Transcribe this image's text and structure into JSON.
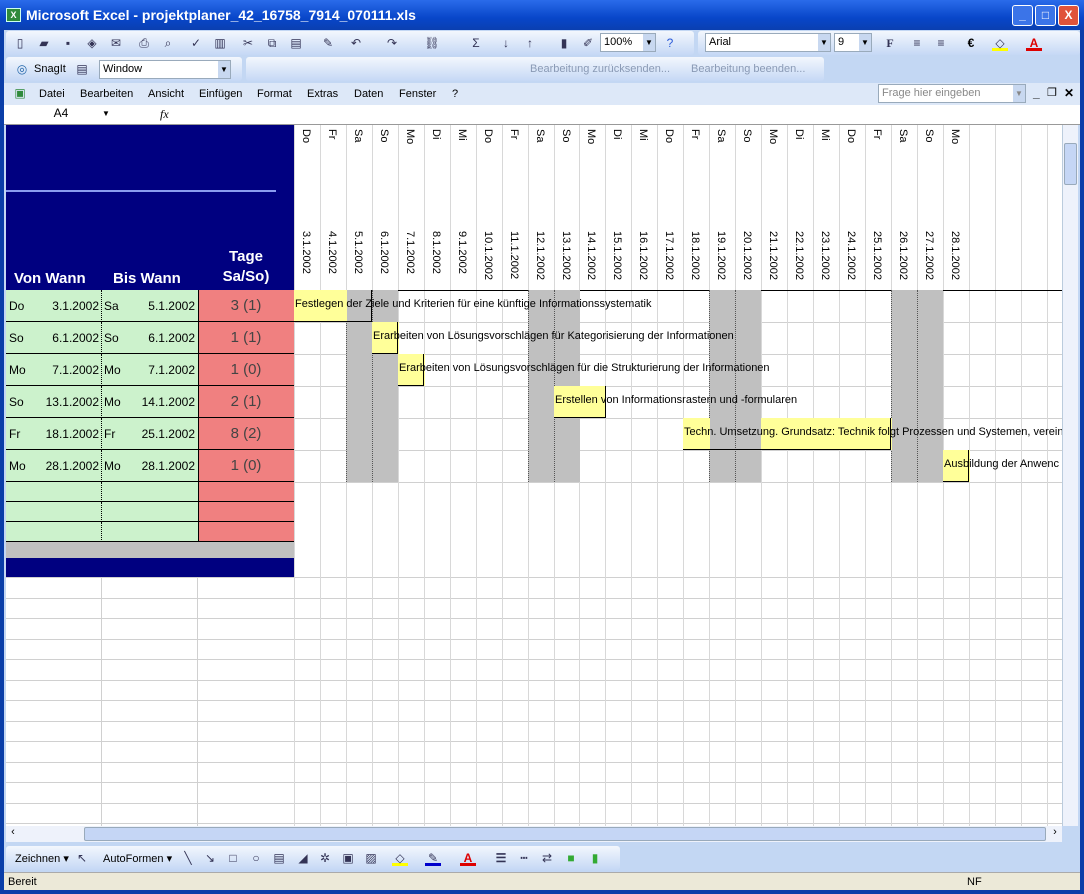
{
  "window": {
    "title": "Microsoft Excel - projektplaner_42_16758_7914_070111.xls",
    "minimize": "_",
    "maximize": "□",
    "close": "X"
  },
  "toolbar": {
    "zoom": "100%",
    "font": "Arial",
    "font_size": "9",
    "bold": "F",
    "euro": "€",
    "icons": [
      "new-icon",
      "open-icon",
      "save-icon",
      "permission-icon",
      "email-icon",
      "print-icon",
      "print-preview-icon",
      "spelling-icon",
      "research-icon",
      "cut-icon",
      "copy-icon",
      "paste-icon",
      "format-painter-icon",
      "undo-icon",
      "redo-icon",
      "hyperlink-icon",
      "autosum-icon",
      "sort-asc-icon",
      "sort-desc-icon",
      "chart-icon",
      "drawing-icon",
      "help-icon"
    ]
  },
  "snagit": {
    "label": "SnagIt",
    "window_combo": "Window",
    "review_send": "Bearbeitung zurücksenden...",
    "review_end": "Bearbeitung beenden..."
  },
  "menu": {
    "items": [
      "Datei",
      "Bearbeiten",
      "Ansicht",
      "Einfügen",
      "Format",
      "Extras",
      "Daten",
      "Fenster",
      "?"
    ],
    "help_placeholder": "Frage hier eingeben"
  },
  "formula_bar": {
    "name_box": "A4",
    "fx": "fx",
    "value": ""
  },
  "sheet": {
    "headers": {
      "von": "Von Wann",
      "bis": "Bis Wann",
      "tage": "Tage\nSa/So)"
    },
    "days": [
      "Do",
      "Fr",
      "Sa",
      "So",
      "Mo",
      "Di",
      "Mi",
      "Do",
      "Fr",
      "Sa",
      "So",
      "Mo",
      "Di",
      "Mi",
      "Do",
      "Fr",
      "Sa",
      "So",
      "Mo",
      "Di",
      "Mi",
      "Do",
      "Fr",
      "Sa",
      "So",
      "Mo"
    ],
    "dates": [
      "3.1.2002",
      "4.1.2002",
      "5.1.2002",
      "6.1.2002",
      "7.1.2002",
      "8.1.2002",
      "9.1.2002",
      "10.1.2002",
      "11.1.2002",
      "12.1.2002",
      "13.1.2002",
      "14.1.2002",
      "15.1.2002",
      "16.1.2002",
      "17.1.2002",
      "18.1.2002",
      "19.1.2002",
      "20.1.2002",
      "21.1.2002",
      "22.1.2002",
      "23.1.2002",
      "24.1.2002",
      "25.1.2002",
      "26.1.2002",
      "27.1.2002",
      "28.1.2002"
    ],
    "tasks": [
      {
        "von_day": "Do",
        "von": "3.1.2002",
        "bis_day": "Sa",
        "bis": "5.1.2002",
        "tage": "3 (1)",
        "start": 0,
        "end": 2,
        "text": "Festlegen der Ziele und Kriterien für eine künftige Informationssystematik"
      },
      {
        "von_day": "So",
        "von": "6.1.2002",
        "bis_day": "So",
        "bis": "6.1.2002",
        "tage": "1 (1)",
        "start": 3,
        "end": 3,
        "text": "Erarbeiten von Lösungsvorschlägen für Kategorisierung der Informationen"
      },
      {
        "von_day": "Mo",
        "von": "7.1.2002",
        "bis_day": "Mo",
        "bis": "7.1.2002",
        "tage": "1 (0)",
        "start": 4,
        "end": 4,
        "text": "Erarbeiten von Lösungsvorschlägen für die Strukturierung der Informationen"
      },
      {
        "von_day": "So",
        "von": "13.1.2002",
        "bis_day": "Mo",
        "bis": "14.1.2002",
        "tage": "2 (1)",
        "start": 10,
        "end": 11,
        "text": "Erstellen von Informationsrastern und -formularen"
      },
      {
        "von_day": "Fr",
        "von": "18.1.2002",
        "bis_day": "Fr",
        "bis": "25.1.2002",
        "tage": "8 (2)",
        "start": 15,
        "end": 22,
        "text": "Techn. Umsetzung. Grundsatz: Technik folgt Prozessen und Systemen, verein"
      },
      {
        "von_day": "Mo",
        "von": "28.1.2002",
        "bis_day": "Mo",
        "bis": "28.1.2002",
        "tage": "1 (0)",
        "start": 25,
        "end": 25,
        "text": "Ausbildung der Anwenc"
      }
    ],
    "colors": {
      "navy": "#000080",
      "green": "#ccf2cc",
      "red": "#f08080",
      "bar": "#ffff99",
      "weekend": "#c0c0c0"
    }
  },
  "drawing": {
    "zeichnen": "Zeichnen",
    "autoformen": "AutoFormen"
  },
  "status": {
    "text": "Bereit",
    "nf": "NF"
  }
}
